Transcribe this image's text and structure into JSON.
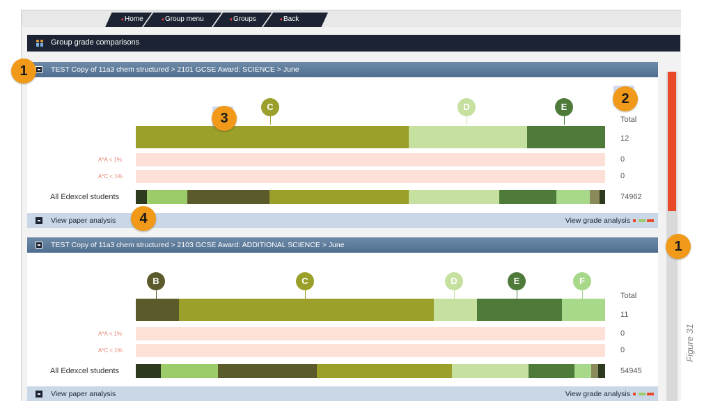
{
  "nav": {
    "tabs": [
      "Home",
      "Group menu",
      "Groups",
      "Back"
    ]
  },
  "title_bar": {
    "label": "Group grade comparisons"
  },
  "panels": [
    {
      "header": "TEST Copy of 11a3 chem structured > 2101 GCSE Award: SCIENCE > June",
      "grades": [
        "C",
        "D",
        "E"
      ],
      "total_label": "Total",
      "rows": [
        {
          "label": "",
          "value": "12"
        },
        {
          "label": "A*A",
          "pct": "< 1%",
          "value": "0"
        },
        {
          "label": "A*C",
          "pct": "< 1%",
          "value": "0"
        },
        {
          "label": "All Edexcel students",
          "value": "74962"
        }
      ],
      "footer_left": "View paper analysis",
      "footer_right": "View grade analysis"
    },
    {
      "header": "TEST Copy of 11a3 chem structured > 2103 GCSE Award: ADDITIONAL SCIENCE > June",
      "grades": [
        "B",
        "C",
        "D",
        "E",
        "F"
      ],
      "total_label": "Total",
      "rows": [
        {
          "label": "",
          "value": "11"
        },
        {
          "label": "A*A",
          "pct": "< 1%",
          "value": "0"
        },
        {
          "label": "A*C",
          "pct": "< 1%",
          "value": "0"
        },
        {
          "label": "All Edexcel students",
          "value": "54945"
        }
      ],
      "footer_left": "View paper analysis",
      "footer_right": "View grade analysis"
    }
  ],
  "callouts": [
    "1",
    "2",
    "3",
    "4",
    "1"
  ],
  "figure_caption": "Figure 31",
  "colors": {
    "grade_b": "#5a5a2a",
    "grade_c": "#9aa02a",
    "grade_d": "#c6e0a0",
    "grade_e": "#4e7a3a",
    "grade_f": "#a8d88a",
    "scroll": "#e84a2a"
  }
}
